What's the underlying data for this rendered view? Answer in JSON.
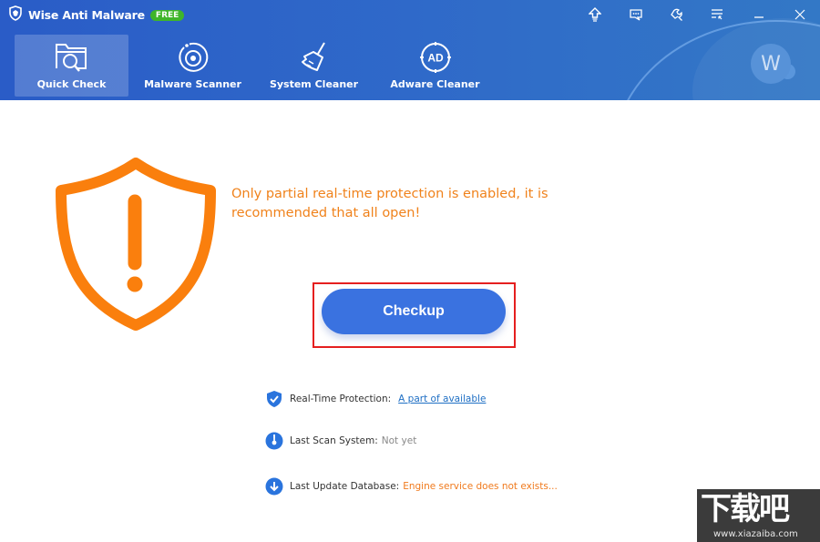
{
  "app": {
    "title": "Wise Anti Malware",
    "badge": "FREE"
  },
  "window_controls": [
    {
      "name": "upgrade-icon"
    },
    {
      "name": "feedback-icon"
    },
    {
      "name": "settings-icon"
    },
    {
      "name": "menu-icon"
    },
    {
      "name": "minimize-icon"
    },
    {
      "name": "close-icon"
    }
  ],
  "nav": {
    "items": [
      {
        "label": "Quick Check",
        "icon": "folder-search-icon",
        "active": true
      },
      {
        "label": "Malware Scanner",
        "icon": "scanner-icon",
        "active": false
      },
      {
        "label": "System Cleaner",
        "icon": "broom-icon",
        "active": false
      },
      {
        "label": "Adware Cleaner",
        "icon": "ad-icon",
        "active": false
      }
    ]
  },
  "user": {
    "avatar_letter": "W"
  },
  "main": {
    "warning": "Only partial real-time protection is enabled, it is recommended that all open!",
    "checkup_label": "Checkup",
    "status": [
      {
        "label": "Real-Time Protection:",
        "value": "A part of available"
      },
      {
        "label": "Last Scan System:",
        "value": "Not yet"
      },
      {
        "label": "Last Update Database:",
        "value": "Engine service does not exists..."
      }
    ]
  },
  "colors": {
    "accent": "#3a72e0",
    "warning": "#f5820f",
    "header": "#2a5cc7"
  },
  "watermark": {
    "cn": "下载吧",
    "url": "www.xiazaiba.com"
  }
}
